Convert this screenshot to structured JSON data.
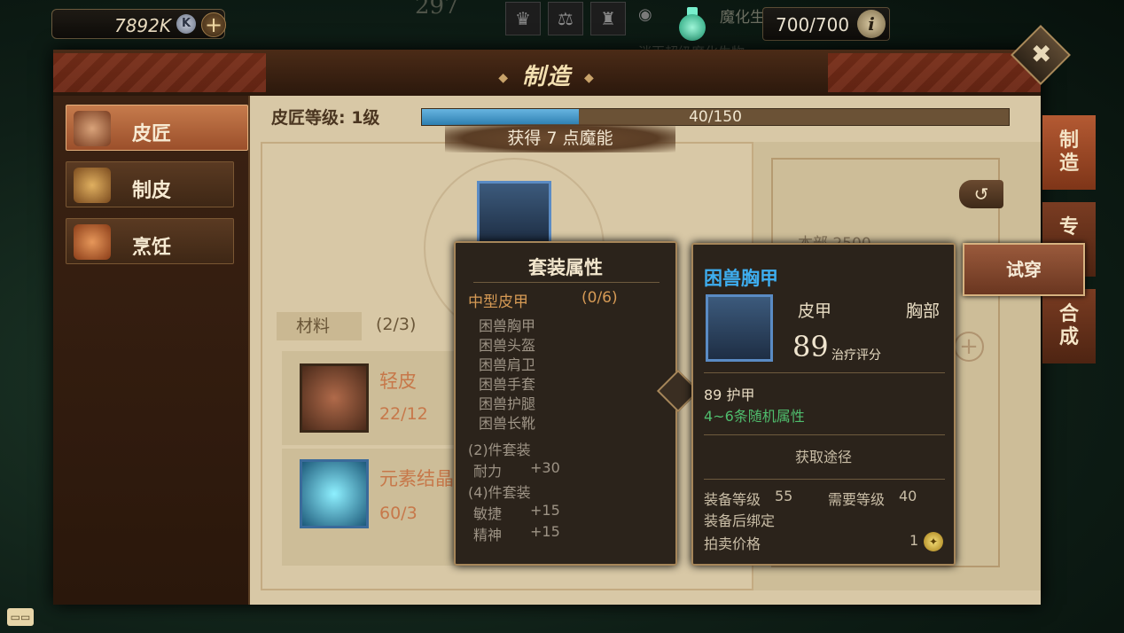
{
  "hud": {
    "currency_value": "7892K",
    "currency_icon": "K",
    "ghost_number": "297",
    "energy_value": "700/700",
    "ghost_top_text": "魔化生物",
    "ghost_top_text2": "消灭超级魔化生物"
  },
  "window": {
    "title": "制造"
  },
  "sidebar": {
    "items": [
      {
        "label": "皮匠",
        "icon": "leather-scroll-icon",
        "active": true
      },
      {
        "label": "制皮",
        "icon": "leather-hide-icon",
        "active": false
      },
      {
        "label": "烹饪",
        "icon": "roast-food-icon",
        "active": false
      }
    ]
  },
  "craft": {
    "level_label": "皮匠等级: 1级",
    "progress_text": "40/150",
    "progress_fraction": 0.267,
    "gain_text": "获得 7 点魔能",
    "materials_tab": "材料",
    "materials_count": "(2/3)",
    "materials": [
      {
        "name": "轻皮",
        "qty": "22/12"
      },
      {
        "name": "元素结晶",
        "qty": "60/3"
      }
    ]
  },
  "right_panel": {
    "ghost_text": "本部 2500"
  },
  "right_tabs": [
    {
      "label": "制造"
    },
    {
      "label": "专"
    },
    {
      "label": "合成"
    }
  ],
  "set_tooltip": {
    "header": "套装属性",
    "group_name": "中型皮甲",
    "group_count": "(0/6)",
    "pieces": [
      "困兽胸甲",
      "困兽头盔",
      "困兽肩卫",
      "困兽手套",
      "困兽护腿",
      "困兽长靴"
    ],
    "bonus2_header": "(2)件套装",
    "bonus2_stat": "耐力",
    "bonus2_value": "+30",
    "bonus4_header": "(4)件套装",
    "bonus4_stat1": "敏捷",
    "bonus4_value1": "+15",
    "bonus4_stat2": "精神",
    "bonus4_value2": "+15"
  },
  "item_tooltip": {
    "name": "困兽胸甲",
    "type": "皮甲",
    "slot": "胸部",
    "score": "89",
    "score_label": "治疗评分",
    "armor": "89 护甲",
    "random_attr": "4~6条随机属性",
    "source_label": "获取途径",
    "equip_level_label": "装备等级",
    "equip_level": "55",
    "req_level_label": "需要等级",
    "req_level": "40",
    "bind_text": "装备后绑定",
    "auction_label": "拍卖价格",
    "auction_price": "1"
  },
  "try_on_button": "试穿",
  "colors": {
    "accent_blue": "#3eaef0",
    "green_attr": "#4fbd6d",
    "material_orange": "#c7784a",
    "set_group_orange": "#d69a55"
  }
}
